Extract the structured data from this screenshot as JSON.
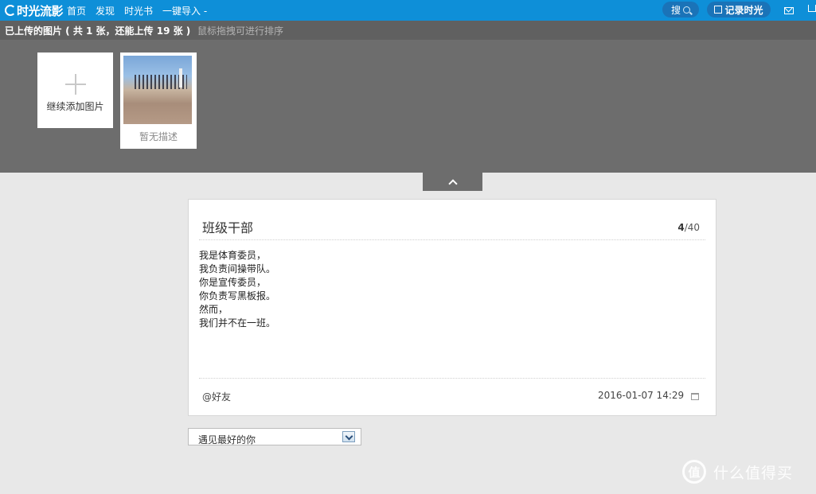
{
  "topnav": {
    "logo_text": "时光流影",
    "links": [
      "首页",
      "发现",
      "时光书",
      "一键导入 -"
    ],
    "search_label": "搜",
    "record_label": "记录时光"
  },
  "upload": {
    "status_text": "已上传的图片 ( 共 1 张，还能上传 19 张 )",
    "hint_text": "鼠标拖拽可进行排序",
    "add_label": "继续添加图片",
    "photo_caption": "暂无描述"
  },
  "entry": {
    "title": "班级干部",
    "count_current": "4",
    "count_total": "/40",
    "body_lines": [
      "我是体育委员，",
      "我负责间操带队。",
      "你是宣传委员，",
      "你负责写黑板报。",
      "然而，",
      "我们并不在一班。"
    ],
    "mention": "@好友",
    "date": "2016-01-07 14:29"
  },
  "select": {
    "value": "遇见最好的你"
  },
  "watermark": {
    "logo_text": "值",
    "text": "什么值得买"
  },
  "icons": {
    "logo": "logo-swirl-icon",
    "search": "search-icon",
    "record": "edit-icon",
    "mail": "mail-icon",
    "cart": "cart-icon",
    "collapse": "chevron-up-icon",
    "calendar": "calendar-icon",
    "select_arrow": "chevron-down-icon",
    "add": "plus-icon"
  }
}
